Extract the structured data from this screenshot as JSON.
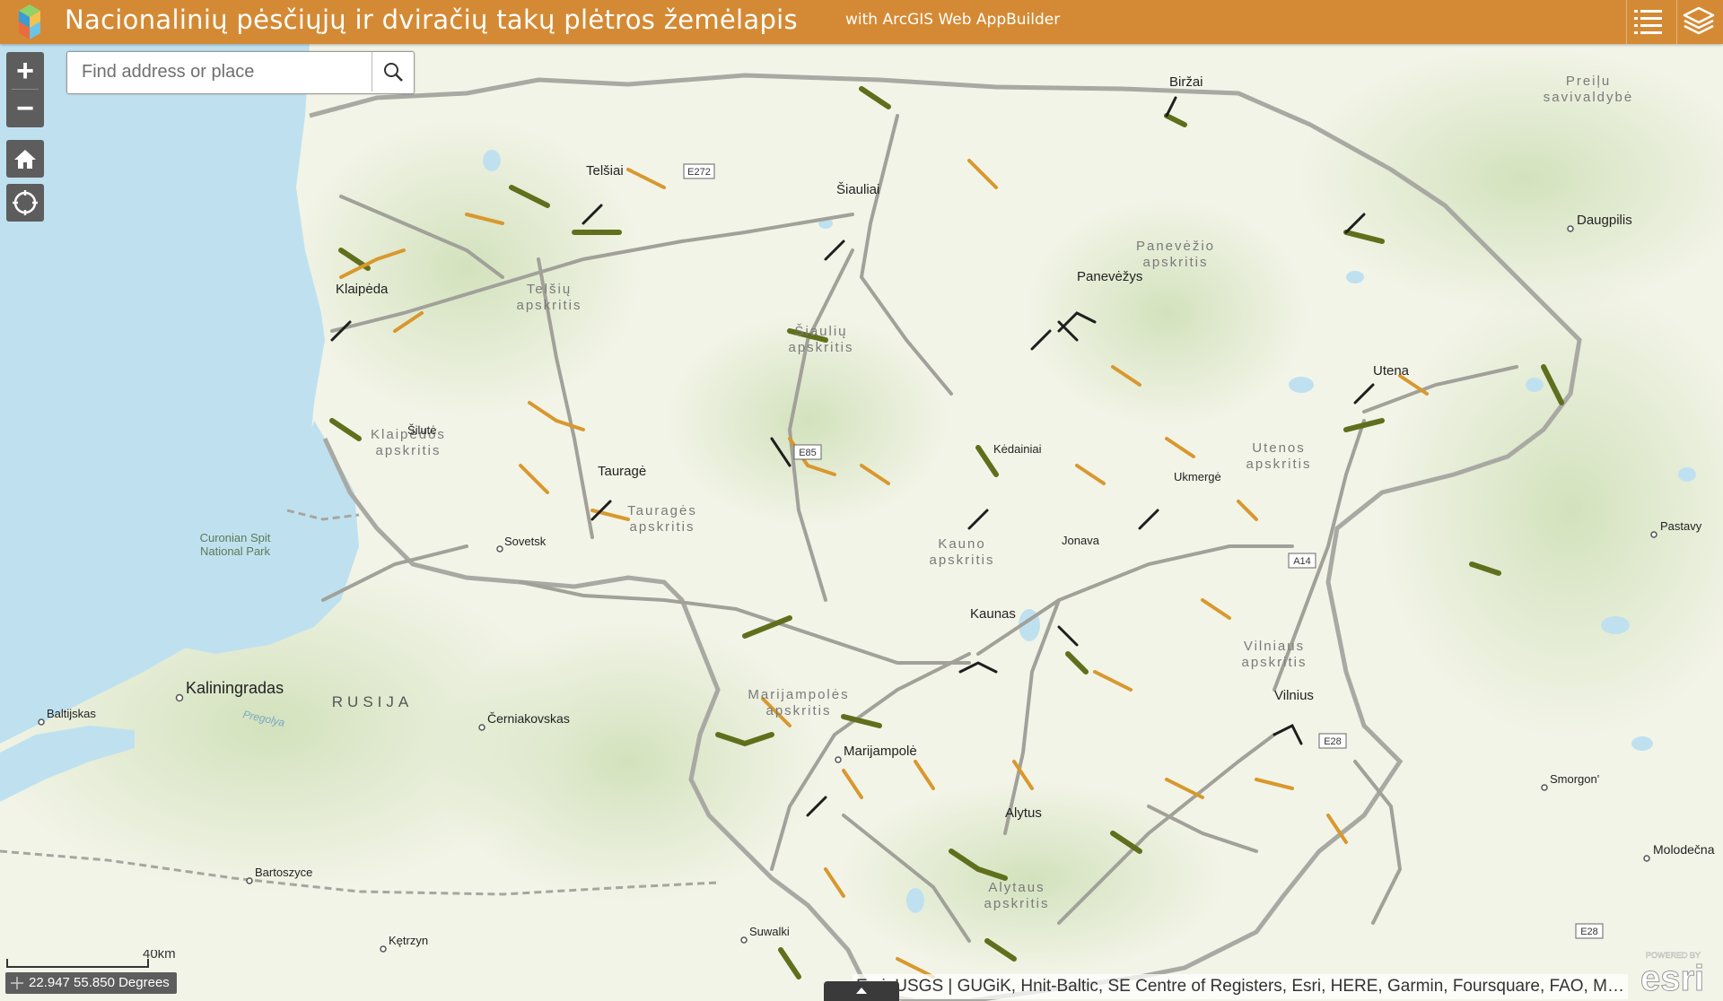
{
  "header": {
    "title": "Nacionalinių pėsčiųjų ir dviračių takų plėtros žemėlapis",
    "subtitle": "with ArcGIS Web AppBuilder",
    "logo_icon": "arcgis-cubes-logo-icon",
    "buttons": [
      {
        "name": "legend-list-button",
        "icon": "list-icon"
      },
      {
        "name": "layers-button",
        "icon": "layers-icon"
      }
    ]
  },
  "search": {
    "placeholder": "Find address or place",
    "value": ""
  },
  "controls": {
    "zoom_in": "+",
    "zoom_out": "−",
    "home": "home-icon",
    "locate": "locate-icon"
  },
  "map": {
    "country_label": "RUSIJA",
    "park_label_1": "Curonian Spit",
    "park_label_2": "National Park",
    "river_label": "Pregolya",
    "region_labels": {
      "telsiu_1": "Telšių",
      "telsiu_2": "apskritis",
      "siauliu_1": "Šiaulių",
      "siauliu_2": "apskritis",
      "panevezio_1": "Panevėžio",
      "panevezio_2": "apskritis",
      "klaipedos_1": "Klaipėdos",
      "klaipedos_2": "apskritis",
      "taurages_1": "Tauragės",
      "taurages_2": "apskritis",
      "utenos_1": "Utenos",
      "utenos_2": "apskritis",
      "kauno_1": "Kauno",
      "kauno_2": "apskritis",
      "vilniaus_1": "Vilniaus",
      "vilniaus_2": "apskritis",
      "marijampoles_1": "Marijampolės",
      "marijampoles_2": "apskritis",
      "alytaus_1": "Alytaus",
      "alytaus_2": "apskritis",
      "preiliu_1": "Preiļu",
      "preiliu_2": "savivaldybė"
    },
    "cities": {
      "birzai": "Biržai",
      "telsiai": "Telšiai",
      "siauliai": "Šiauliai",
      "panevezys": "Panevėžys",
      "klaipeda": "Klaipėda",
      "silute": "Šilutė",
      "taurage": "Tauragė",
      "kedainiai": "Kėdainiai",
      "ukmerge": "Ukmergė",
      "utena": "Utena",
      "jonava": "Jonava",
      "sovetsk": "Sovetsk",
      "kaunas": "Kaunas",
      "vilnius": "Vilnius",
      "kaliningradas": "Kaliningradas",
      "baltijskas": "Baltijskas",
      "cerniakovskas": "Černiakovskas",
      "marijampole": "Marijampolė",
      "alytus": "Alytus",
      "daugpilis": "Daugpilis",
      "pastavy": "Pastavy",
      "smorgon": "Smorgon'",
      "molodecna": "Molodečna",
      "bartoszyce": "Bartoszyce",
      "suwalki": "Suwalki",
      "ketrzyn": "Kętrzyn"
    },
    "road_shields": {
      "e272": "E272",
      "e85": "E85",
      "a14": "A14",
      "e28": "E28",
      "e28b": "E28"
    },
    "colors": {
      "land_lt": "#f3f4e8",
      "land_green": "#dfe9cd",
      "water": "#bfe1ef",
      "path_orange": "#d8982e",
      "path_olive": "#5f6f1c",
      "path_gray": "#9a9a90",
      "header": "#d48a34"
    }
  },
  "scalebar": {
    "label": "40km"
  },
  "coordinates": {
    "text": "22.947 55.850 Degrees"
  },
  "attribution": {
    "text": "Esri, USGS | GUGiK, Hnit-Baltic, SE Centre of Registers, Esri, HERE, Garmin, Foursquare, FAO, METI/N..."
  },
  "esri_logo": {
    "small": "POWERED BY",
    "brand": "esri"
  }
}
